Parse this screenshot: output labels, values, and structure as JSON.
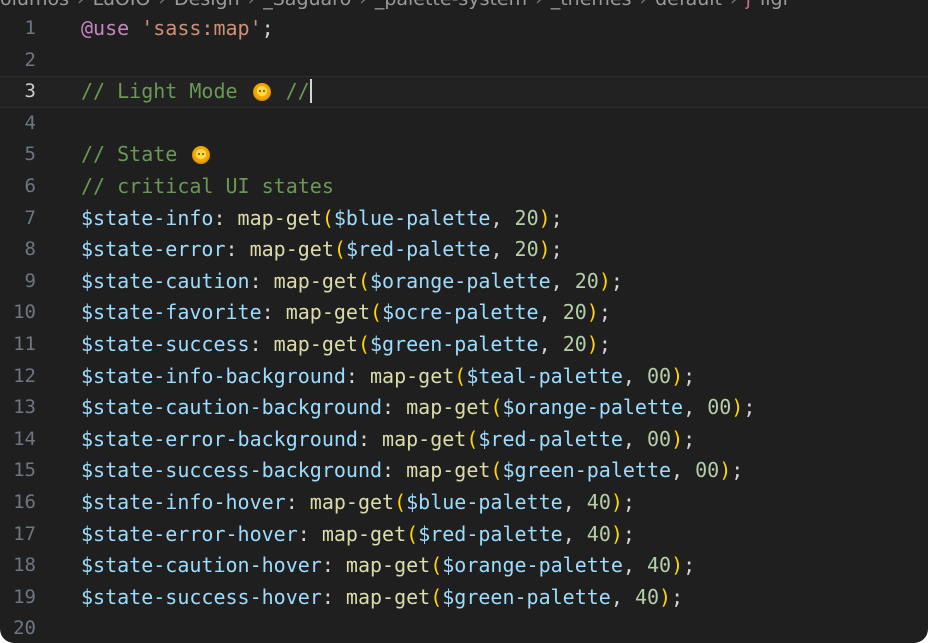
{
  "breadcrumb": {
    "items": [
      "olumos",
      "LuOIO",
      "Design",
      "_Saguaro",
      "_palette-system",
      "_themes",
      "default",
      "ligi"
    ],
    "separator": "›",
    "file_icon": "sass-icon"
  },
  "editor": {
    "current_line": 3,
    "lines": [
      {
        "num": "1",
        "tokens": [
          {
            "t": "@use",
            "c": "at"
          },
          {
            "t": " ",
            "c": "punct"
          },
          {
            "t": "'sass:map'",
            "c": "str"
          },
          {
            "t": ";",
            "c": "punct"
          }
        ]
      },
      {
        "num": "2",
        "tokens": []
      },
      {
        "num": "3",
        "tokens": [
          {
            "t": "// Light Mode ",
            "c": "comment"
          },
          {
            "e": "sun-emoji-icon"
          },
          {
            "t": " //",
            "c": "comment"
          },
          {
            "cursor": true
          }
        ]
      },
      {
        "num": "4",
        "tokens": []
      },
      {
        "num": "5",
        "tokens": [
          {
            "t": "// State ",
            "c": "comment"
          },
          {
            "e": "sun-emoji-icon"
          }
        ]
      },
      {
        "num": "6",
        "tokens": [
          {
            "t": "// critical UI states",
            "c": "comment"
          }
        ]
      },
      {
        "num": "7",
        "tokens": [
          {
            "t": "$state-info",
            "c": "var"
          },
          {
            "t": ": ",
            "c": "punct"
          },
          {
            "t": "map-get",
            "c": "fn"
          },
          {
            "t": "(",
            "c": "paren"
          },
          {
            "t": "$blue-palette",
            "c": "var"
          },
          {
            "t": ", ",
            "c": "punct"
          },
          {
            "t": "20",
            "c": "num"
          },
          {
            "t": ")",
            "c": "paren"
          },
          {
            "t": ";",
            "c": "punct"
          }
        ]
      },
      {
        "num": "8",
        "tokens": [
          {
            "t": "$state-error",
            "c": "var"
          },
          {
            "t": ": ",
            "c": "punct"
          },
          {
            "t": "map-get",
            "c": "fn"
          },
          {
            "t": "(",
            "c": "paren"
          },
          {
            "t": "$red-palette",
            "c": "var"
          },
          {
            "t": ", ",
            "c": "punct"
          },
          {
            "t": "20",
            "c": "num"
          },
          {
            "t": ")",
            "c": "paren"
          },
          {
            "t": ";",
            "c": "punct"
          }
        ]
      },
      {
        "num": "9",
        "tokens": [
          {
            "t": "$state-caution",
            "c": "var"
          },
          {
            "t": ": ",
            "c": "punct"
          },
          {
            "t": "map-get",
            "c": "fn"
          },
          {
            "t": "(",
            "c": "paren"
          },
          {
            "t": "$orange-palette",
            "c": "var"
          },
          {
            "t": ", ",
            "c": "punct"
          },
          {
            "t": "20",
            "c": "num"
          },
          {
            "t": ")",
            "c": "paren"
          },
          {
            "t": ";",
            "c": "punct"
          }
        ]
      },
      {
        "num": "10",
        "tokens": [
          {
            "t": "$state-favorite",
            "c": "var"
          },
          {
            "t": ": ",
            "c": "punct"
          },
          {
            "t": "map-get",
            "c": "fn"
          },
          {
            "t": "(",
            "c": "paren"
          },
          {
            "t": "$ocre-palette",
            "c": "var"
          },
          {
            "t": ", ",
            "c": "punct"
          },
          {
            "t": "20",
            "c": "num"
          },
          {
            "t": ")",
            "c": "paren"
          },
          {
            "t": ";",
            "c": "punct"
          }
        ]
      },
      {
        "num": "11",
        "tokens": [
          {
            "t": "$state-success",
            "c": "var"
          },
          {
            "t": ": ",
            "c": "punct"
          },
          {
            "t": "map-get",
            "c": "fn"
          },
          {
            "t": "(",
            "c": "paren"
          },
          {
            "t": "$green-palette",
            "c": "var"
          },
          {
            "t": ", ",
            "c": "punct"
          },
          {
            "t": "20",
            "c": "num"
          },
          {
            "t": ")",
            "c": "paren"
          },
          {
            "t": ";",
            "c": "punct"
          }
        ]
      },
      {
        "num": "12",
        "tokens": [
          {
            "t": "$state-info-background",
            "c": "var"
          },
          {
            "t": ": ",
            "c": "punct"
          },
          {
            "t": "map-get",
            "c": "fn"
          },
          {
            "t": "(",
            "c": "paren"
          },
          {
            "t": "$teal-palette",
            "c": "var"
          },
          {
            "t": ", ",
            "c": "punct"
          },
          {
            "t": "00",
            "c": "num"
          },
          {
            "t": ")",
            "c": "paren"
          },
          {
            "t": ";",
            "c": "punct"
          }
        ]
      },
      {
        "num": "13",
        "tokens": [
          {
            "t": "$state-caution-background",
            "c": "var"
          },
          {
            "t": ": ",
            "c": "punct"
          },
          {
            "t": "map-get",
            "c": "fn"
          },
          {
            "t": "(",
            "c": "paren"
          },
          {
            "t": "$orange-palette",
            "c": "var"
          },
          {
            "t": ", ",
            "c": "punct"
          },
          {
            "t": "00",
            "c": "num"
          },
          {
            "t": ")",
            "c": "paren"
          },
          {
            "t": ";",
            "c": "punct"
          }
        ]
      },
      {
        "num": "14",
        "tokens": [
          {
            "t": "$state-error-background",
            "c": "var"
          },
          {
            "t": ": ",
            "c": "punct"
          },
          {
            "t": "map-get",
            "c": "fn"
          },
          {
            "t": "(",
            "c": "paren"
          },
          {
            "t": "$red-palette",
            "c": "var"
          },
          {
            "t": ", ",
            "c": "punct"
          },
          {
            "t": "00",
            "c": "num"
          },
          {
            "t": ")",
            "c": "paren"
          },
          {
            "t": ";",
            "c": "punct"
          }
        ]
      },
      {
        "num": "15",
        "tokens": [
          {
            "t": "$state-success-background",
            "c": "var"
          },
          {
            "t": ": ",
            "c": "punct"
          },
          {
            "t": "map-get",
            "c": "fn"
          },
          {
            "t": "(",
            "c": "paren"
          },
          {
            "t": "$green-palette",
            "c": "var"
          },
          {
            "t": ", ",
            "c": "punct"
          },
          {
            "t": "00",
            "c": "num"
          },
          {
            "t": ")",
            "c": "paren"
          },
          {
            "t": ";",
            "c": "punct"
          }
        ]
      },
      {
        "num": "16",
        "tokens": [
          {
            "t": "$state-info-hover",
            "c": "var"
          },
          {
            "t": ": ",
            "c": "punct"
          },
          {
            "t": "map-get",
            "c": "fn"
          },
          {
            "t": "(",
            "c": "paren"
          },
          {
            "t": "$blue-palette",
            "c": "var"
          },
          {
            "t": ", ",
            "c": "punct"
          },
          {
            "t": "40",
            "c": "num"
          },
          {
            "t": ")",
            "c": "paren"
          },
          {
            "t": ";",
            "c": "punct"
          }
        ]
      },
      {
        "num": "17",
        "tokens": [
          {
            "t": "$state-error-hover",
            "c": "var"
          },
          {
            "t": ": ",
            "c": "punct"
          },
          {
            "t": "map-get",
            "c": "fn"
          },
          {
            "t": "(",
            "c": "paren"
          },
          {
            "t": "$red-palette",
            "c": "var"
          },
          {
            "t": ", ",
            "c": "punct"
          },
          {
            "t": "40",
            "c": "num"
          },
          {
            "t": ")",
            "c": "paren"
          },
          {
            "t": ";",
            "c": "punct"
          }
        ]
      },
      {
        "num": "18",
        "tokens": [
          {
            "t": "$state-caution-hover",
            "c": "var"
          },
          {
            "t": ": ",
            "c": "punct"
          },
          {
            "t": "map-get",
            "c": "fn"
          },
          {
            "t": "(",
            "c": "paren"
          },
          {
            "t": "$orange-palette",
            "c": "var"
          },
          {
            "t": ", ",
            "c": "punct"
          },
          {
            "t": "40",
            "c": "num"
          },
          {
            "t": ")",
            "c": "paren"
          },
          {
            "t": ";",
            "c": "punct"
          }
        ]
      },
      {
        "num": "19",
        "tokens": [
          {
            "t": "$state-success-hover",
            "c": "var"
          },
          {
            "t": ": ",
            "c": "punct"
          },
          {
            "t": "map-get",
            "c": "fn"
          },
          {
            "t": "(",
            "c": "paren"
          },
          {
            "t": "$green-palette",
            "c": "var"
          },
          {
            "t": ", ",
            "c": "punct"
          },
          {
            "t": "40",
            "c": "num"
          },
          {
            "t": ")",
            "c": "paren"
          },
          {
            "t": ";",
            "c": "punct"
          }
        ]
      },
      {
        "num": "20",
        "tokens": []
      }
    ]
  },
  "colors": {
    "background": "#1f1f1f",
    "at_rule": "#c586c0",
    "string": "#ce9178",
    "comment": "#6a9955",
    "variable": "#9cdcfe",
    "function": "#dcdcaa",
    "bracket": "#ffd700",
    "number": "#b5cea8",
    "line_number": "#6e7681"
  }
}
